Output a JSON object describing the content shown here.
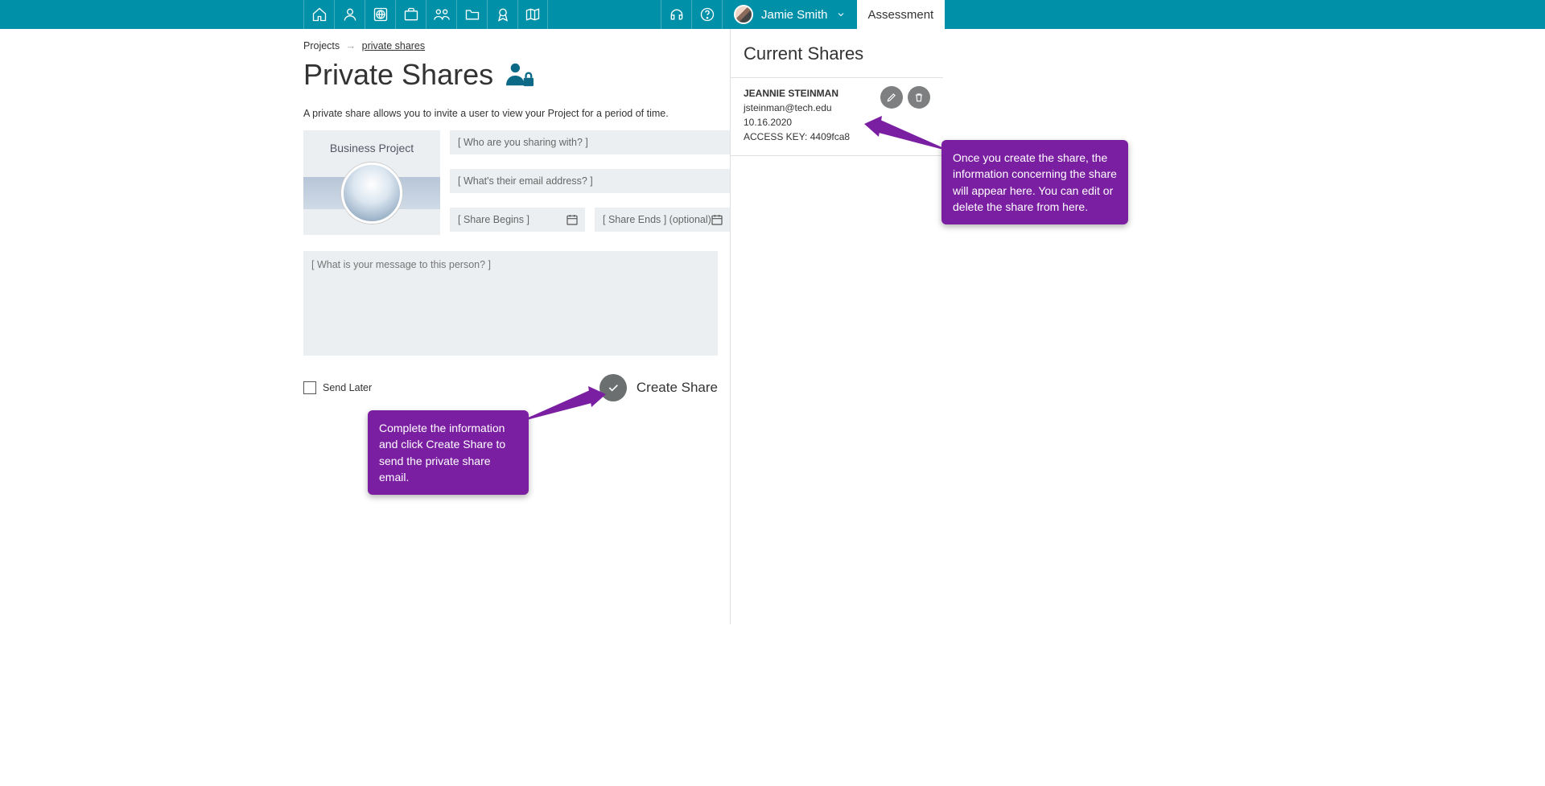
{
  "colors": {
    "brand": "#0091a8",
    "callout": "#7b1fa2"
  },
  "topbar": {
    "user_name": "Jamie Smith",
    "assessment_label": "Assessment"
  },
  "breadcrumb": {
    "root": "Projects",
    "current": "private shares"
  },
  "page": {
    "title": "Private Shares",
    "description": "A private share allows you to invite a user to view your Project for a period of time."
  },
  "project": {
    "name": "Business Project"
  },
  "form": {
    "who_placeholder": "[ Who are you sharing with? ]",
    "email_placeholder": "[ What's their email address? ]",
    "begins_placeholder": "[ Share Begins ]",
    "ends_placeholder": "[ Share Ends ] (optional)",
    "message_placeholder": "[ What is your message to this person? ]",
    "send_later_label": "Send Later",
    "create_share_label": "Create Share"
  },
  "side": {
    "title": "Current Shares",
    "share": {
      "name": "JEANNIE STEINMAN",
      "email": "jsteinman@tech.edu",
      "date": "10.16.2020",
      "access_key_label": "ACCESS KEY:",
      "access_key": "4409fca8"
    }
  },
  "callouts": {
    "c1": "Complete the information and click Create Share to send the private share email.",
    "c2": "Once you create the share, the information concerning the share will appear here.  You can edit or delete the share from here."
  }
}
